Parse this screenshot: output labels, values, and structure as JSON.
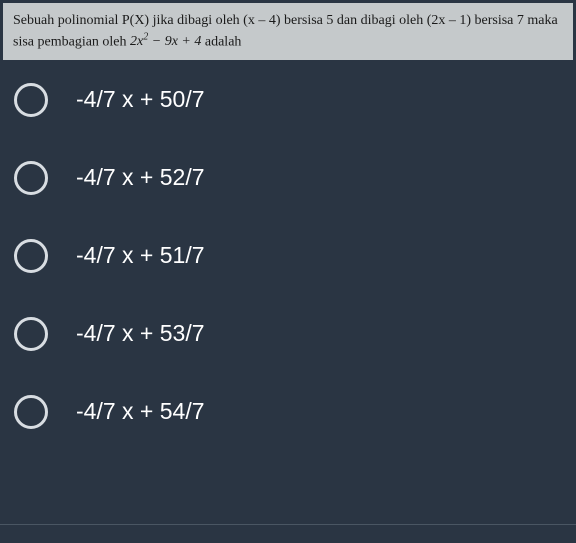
{
  "question": {
    "text_part1": "Sebuah polinomial P(X) jika dibagi oleh (x – 4) bersisa 5 dan dibagi oleh (2x – 1) bersisa 7 maka sisa pembagian oleh ",
    "math_expr": "2x² − 9x + 4",
    "text_part2": " adalah"
  },
  "options": [
    {
      "label": "-4/7 x + 50/7"
    },
    {
      "label": "-4/7 x + 52/7"
    },
    {
      "label": "-4/7 x + 51/7"
    },
    {
      "label": "-4/7 x + 53/7"
    },
    {
      "label": "-4/7 x + 54/7"
    }
  ]
}
